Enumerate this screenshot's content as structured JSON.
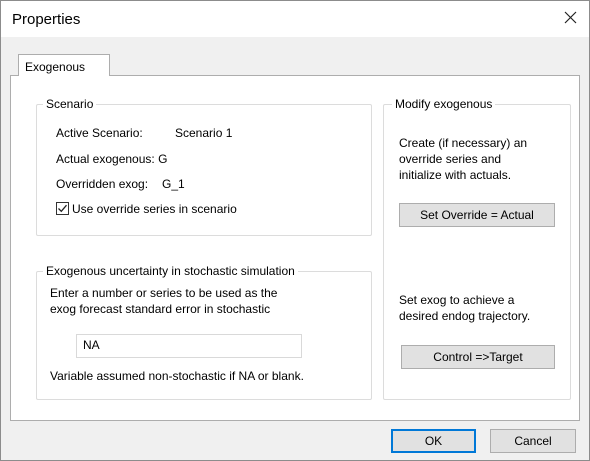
{
  "window": {
    "title": "Properties"
  },
  "tabs": [
    {
      "label": "Exogenous"
    }
  ],
  "scenario": {
    "title": "Scenario",
    "active_label": "Active Scenario:",
    "active_value": "Scenario 1",
    "actual_label": "Actual exogenous: G",
    "overridden_label": "Overridden exog:",
    "overridden_value": "G_1",
    "checkbox_label": "Use override series in scenario",
    "checkbox_checked": true
  },
  "uncertainty": {
    "title": "Exogenous uncertainty in stochastic simulation",
    "desc_line1": "Enter a number or series to be used as the",
    "desc_line2": "exog forecast standard error in stochastic",
    "input_value": "NA",
    "note": "Variable assumed non-stochastic if NA or blank."
  },
  "modify": {
    "title": "Modify exogenous",
    "desc1_line1": "Create (if necessary) an",
    "desc1_line2": "override series and",
    "desc1_line3": "initialize with actuals.",
    "override_button": "Set Override = Actual",
    "desc2_line1": "Set exog to achieve a",
    "desc2_line2": "desired endog trajectory.",
    "control_button": "Control =>Target"
  },
  "footer": {
    "ok_label": "OK",
    "cancel_label": "Cancel"
  },
  "colors": {
    "accent": "#0078d7",
    "button_bg": "#e1e1e1",
    "dialog_bg": "#f0f0f0"
  }
}
